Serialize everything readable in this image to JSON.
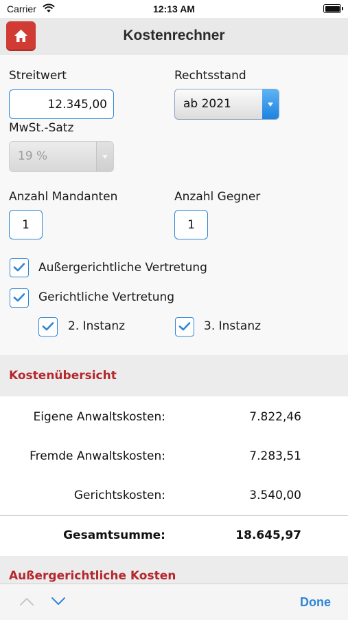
{
  "status_bar": {
    "carrier": "Carrier",
    "time": "12:13 AM"
  },
  "nav": {
    "title": "Kostenrechner"
  },
  "form": {
    "streitwert_label": "Streitwert",
    "streitwert_value": "12.345,00",
    "rechtsstand_label": "Rechtsstand",
    "rechtsstand_value": "ab 2021",
    "mwst_label": "MwSt.-Satz",
    "mwst_value": "19 %",
    "mandanten_label": "Anzahl Mandanten",
    "mandanten_value": "1",
    "gegner_label": "Anzahl Gegner",
    "gegner_value": "1",
    "aussergerichtlich_label": "Außergerichtliche Vertretung",
    "gerichtlich_label": "Gerichtliche Vertretung",
    "instanz2_label": "2. Instanz",
    "instanz3_label": "3. Instanz"
  },
  "overview": {
    "title": "Kostenübersicht",
    "rows": [
      {
        "label": "Eigene Anwaltskosten:",
        "value": "7.822,46"
      },
      {
        "label": "Fremde Anwaltskosten:",
        "value": "7.283,51"
      },
      {
        "label": "Gerichtskosten:",
        "value": "3.540,00"
      }
    ],
    "total_label": "Gesamtsumme:",
    "total_value": "18.645,97"
  },
  "next_section": {
    "title": "Außergerichtliche Kosten"
  },
  "toolbar": {
    "done_label": "Done"
  },
  "colors": {
    "accent": "#2f86d6",
    "brand_red": "#d03b33",
    "section_red": "#b5272d"
  }
}
